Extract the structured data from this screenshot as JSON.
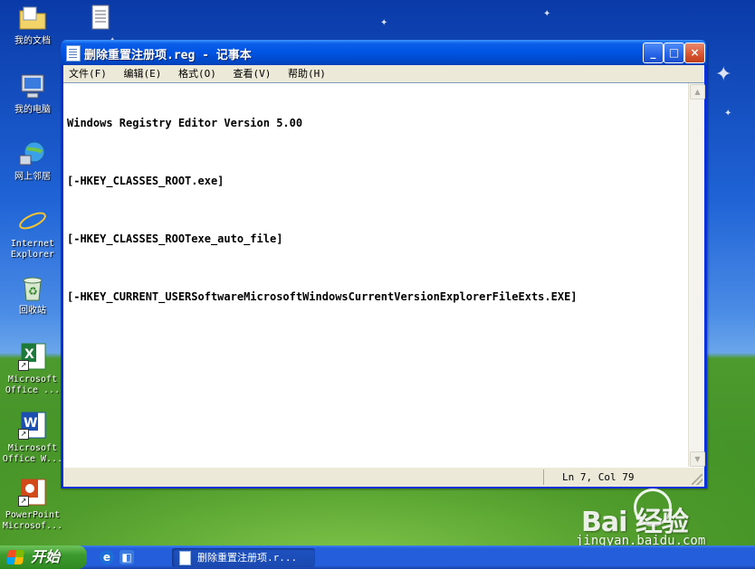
{
  "desktop": {
    "icons": [
      {
        "label": "我的文档",
        "icon": "my-documents-icon"
      },
      {
        "label": "我的电脑",
        "icon": "my-computer-icon"
      },
      {
        "label": "网上邻居",
        "icon": "network-places-icon"
      },
      {
        "label": "Internet Explorer",
        "icon": "internet-explorer-icon"
      },
      {
        "label": "回收站",
        "icon": "recycle-bin-icon"
      },
      {
        "label": "Microsoft Office ...",
        "icon": "excel-icon"
      },
      {
        "label": "Microsoft Office W...",
        "icon": "word-icon"
      },
      {
        "label": "PowerPoint Microsof...",
        "icon": "powerpoint-icon"
      }
    ]
  },
  "window": {
    "title": "删除重置注册项.reg - 记事本",
    "minimize_glyph": "_",
    "maximize_glyph": "□",
    "close_glyph": "×"
  },
  "menu": {
    "file": "文件(F)",
    "edit": "编辑(E)",
    "format": "格式(O)",
    "view": "查看(V)",
    "help": "帮助(H)"
  },
  "editor": {
    "lines": [
      "Windows Registry Editor Version 5.00",
      "[-HKEY_CLASSES_ROOT.exe]",
      "[-HKEY_CLASSES_ROOTexe_auto_file]",
      "[-HKEY_CURRENT_USERSoftwareMicrosoftWindowsCurrentVersionExplorerFileExts.EXE]"
    ]
  },
  "statusbar": {
    "position": "Ln 7, Col 79"
  },
  "taskbar": {
    "start_label": "开始",
    "task_label": "删除重置注册项.r..."
  },
  "watermark": {
    "logo": "Bai  经验",
    "url": "jingyan.baidu.com"
  },
  "colors": {
    "titlebar": "#0054e3",
    "menubar": "#ece9d8",
    "taskbar": "#245edb",
    "start": "#3c9a2d"
  }
}
